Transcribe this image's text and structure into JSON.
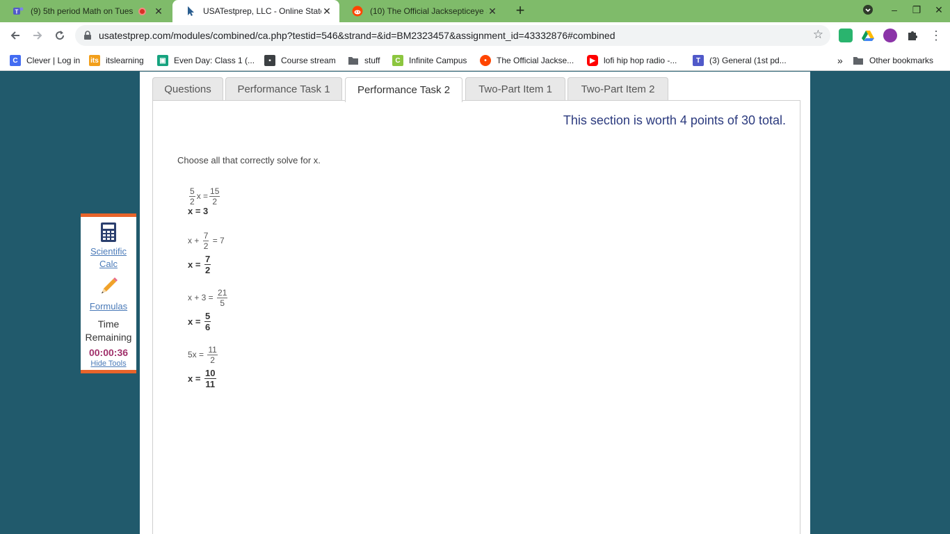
{
  "browser": {
    "tabs": [
      {
        "title": "(9) 5th period Math on Tues",
        "active": false
      },
      {
        "title": "USATestprep, LLC - Online State-S",
        "active": true
      },
      {
        "title": "(10) The Official Jacksepticeye S",
        "active": false
      }
    ],
    "url": "usatestprep.com/modules/combined/ca.php?testid=546&strand=&id=BM2323457&assignment_id=43332876#combined",
    "bookmarks": [
      {
        "label": "Clever | Log in",
        "icon": "clever-icon"
      },
      {
        "label": "itslearning",
        "icon": "itslearning-icon"
      },
      {
        "label": "Even Day: Class 1 (...",
        "icon": "classroom-icon"
      },
      {
        "label": "Course stream",
        "icon": "course-stream-icon"
      },
      {
        "label": "stuff",
        "icon": "folder-icon"
      },
      {
        "label": "Infinite Campus",
        "icon": "infinite-campus-icon"
      },
      {
        "label": "The Official Jackse...",
        "icon": "reddit-icon"
      },
      {
        "label": "lofi hip hop radio -...",
        "icon": "youtube-icon"
      },
      {
        "label": "(3) General (1st pd...",
        "icon": "teams-icon"
      }
    ],
    "other_bookmarks": "Other bookmarks"
  },
  "page": {
    "tabs": [
      "Questions",
      "Performance Task 1",
      "Performance Task 2",
      "Two-Part Item 1",
      "Two-Part Item 2"
    ],
    "active_tab": "Performance Task 2",
    "worth": "This section is worth 4 points of 30 total.",
    "prompt": "Choose all that correctly solve for x.",
    "options": [
      {
        "equation": {
          "pre": "",
          "frac1": [
            "5",
            "2"
          ],
          "mid": "x = ",
          "frac2": [
            "15",
            "2"
          ],
          "post": ""
        },
        "solution": {
          "lead": "x = ",
          "text": "3",
          "frac": null
        }
      },
      {
        "equation": {
          "pre": "x + ",
          "frac1": [
            "7",
            "2"
          ],
          "mid": " = 7",
          "frac2": null,
          "post": ""
        },
        "solution": {
          "lead": "x = ",
          "text": "",
          "frac": [
            "7",
            "2"
          ]
        }
      },
      {
        "equation": {
          "pre": "x + 3 = ",
          "frac1": [
            "21",
            "5"
          ],
          "mid": "",
          "frac2": null,
          "post": ""
        },
        "solution": {
          "lead": "x = ",
          "text": "",
          "frac": [
            "5",
            "6"
          ]
        }
      },
      {
        "equation": {
          "pre": "5x = ",
          "frac1": [
            "11",
            "2"
          ],
          "mid": "",
          "frac2": null,
          "post": ""
        },
        "solution": {
          "lead": "x = ",
          "text": "",
          "frac": [
            "10",
            "11"
          ]
        }
      }
    ]
  },
  "tools": {
    "calc_line1": "Scientific",
    "calc_line2": "Calc",
    "formulas": "Formulas",
    "time_line1": "Time",
    "time_line2": "Remaining",
    "timer": "00:00:36",
    "hide": "Hide Tools"
  },
  "colors": {
    "tabbar": "#7fbb6a",
    "page_bg": "#215a6c",
    "accent_orange": "#e8642a",
    "worth_text": "#2b3a7e",
    "timer_text": "#a0306a"
  }
}
